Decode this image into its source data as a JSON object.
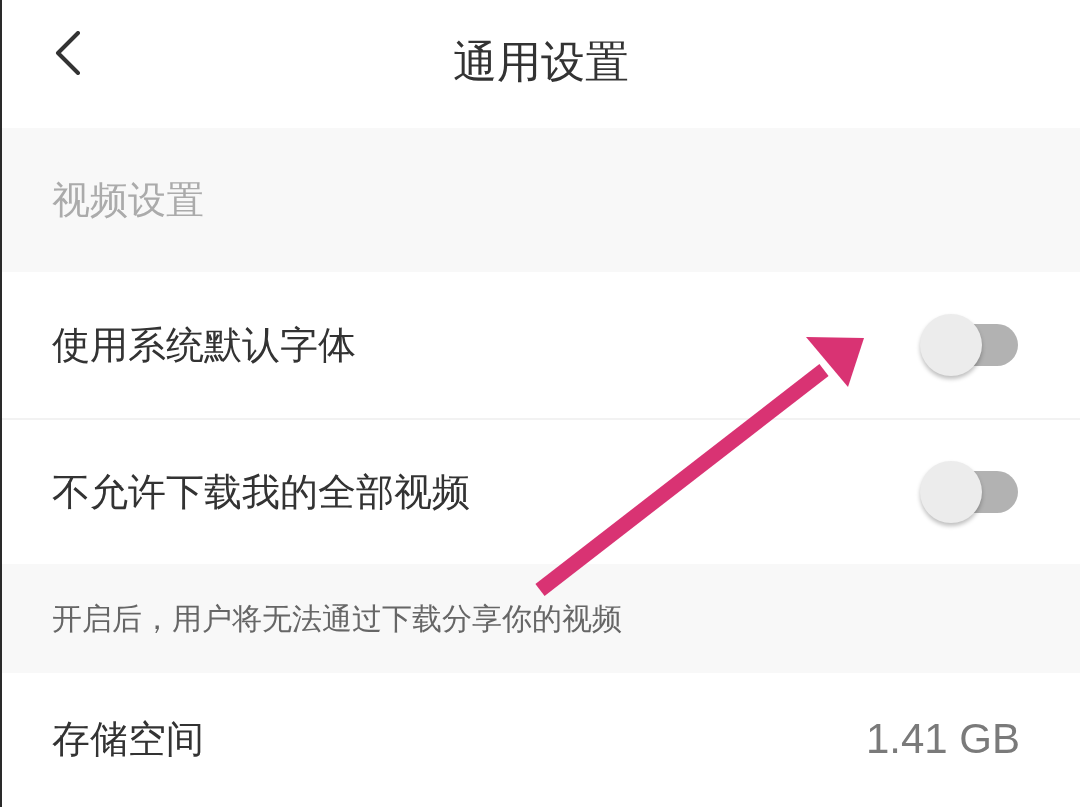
{
  "header": {
    "title": "通用设置"
  },
  "section_title": "视频设置",
  "settings": [
    {
      "kind": "toggle",
      "label": "使用系统默认字体",
      "on": false
    },
    {
      "kind": "toggle",
      "label": "不允许下载我的全部视频",
      "on": false,
      "note": "开启后，用户将无法通过下载分享你的视频"
    },
    {
      "kind": "value",
      "label": "存储空间",
      "value": "1.41 GB"
    }
  ]
}
